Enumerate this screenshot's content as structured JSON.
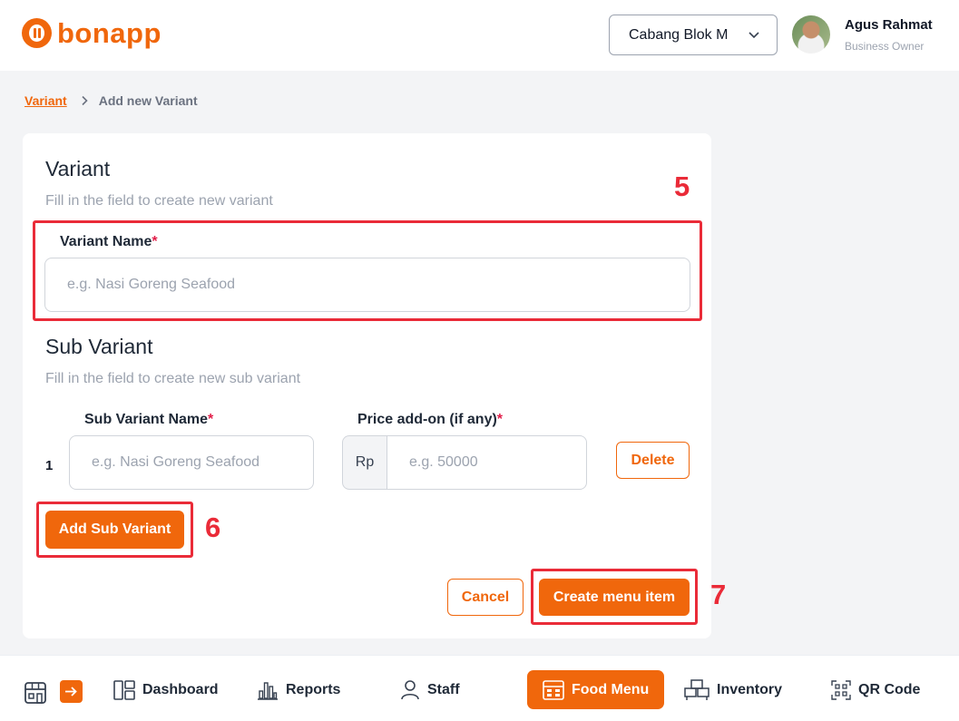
{
  "brand": {
    "name": "bonapp",
    "color": "#f0670c"
  },
  "header": {
    "branch_selector": "Cabang Blok M",
    "user_name": "Agus Rahmat",
    "user_role": "Business Owner"
  },
  "breadcrumb": {
    "parent": "Variant",
    "current": "Add new Variant"
  },
  "variant": {
    "title": "Variant",
    "subtitle": "Fill in the field to create new variant",
    "name_label": "Variant Name",
    "name_placeholder": "e.g. Nasi Goreng Seafood",
    "required_mark": "*"
  },
  "sub_variant": {
    "title": "Sub Variant",
    "subtitle": "Fill in the field to create new sub variant",
    "name_label": "Sub Variant Name",
    "price_label": "Price add-on (if any)",
    "required_mark": "*",
    "rows": [
      {
        "index": "1",
        "name_placeholder": "e.g. Nasi Goreng Seafood",
        "currency": "Rp",
        "price_placeholder": "e.g. 50000",
        "delete_label": "Delete"
      }
    ],
    "add_label": "Add Sub Variant"
  },
  "actions": {
    "cancel_label": "Cancel",
    "submit_label": "Create menu item"
  },
  "annotations": [
    "5",
    "6",
    "7"
  ],
  "annotation_color": "#ea2b38",
  "bottom_nav": {
    "items": [
      {
        "label": "Dashboard",
        "icon": "dashboard-icon"
      },
      {
        "label": "Reports",
        "icon": "bar-chart-icon"
      },
      {
        "label": "Staff",
        "icon": "person-icon"
      },
      {
        "label": "Food Menu",
        "icon": "food-menu-icon",
        "active": true
      },
      {
        "label": "Inventory",
        "icon": "inventory-icon"
      },
      {
        "label": "QR Code",
        "icon": "qr-code-icon"
      }
    ]
  }
}
